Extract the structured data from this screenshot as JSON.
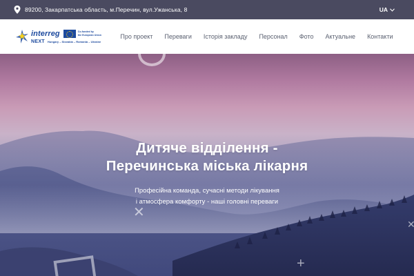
{
  "topbar": {
    "address": "89200, Закарпатська область, м.Перечин, вул.Ужанська, 8",
    "language": "UA",
    "icons": {
      "location": "map-pin-icon",
      "chevron": "chevron-down-icon"
    }
  },
  "logo": {
    "word": "interreg",
    "eu_text_line1": "Co-funded by",
    "eu_text_line2": "the European Union",
    "next": "NEXT",
    "countries": "Hungary – Slovakia – Romania – Ukraine"
  },
  "nav": {
    "items": [
      {
        "label": "Про проект"
      },
      {
        "label": "Переваги"
      },
      {
        "label": "Історія закладу"
      },
      {
        "label": "Персонал"
      },
      {
        "label": "Фото"
      },
      {
        "label": "Актуальне"
      },
      {
        "label": "Контакти"
      }
    ]
  },
  "hero": {
    "title_line1": "Дитяче відділення -",
    "title_line2": "Перечинська міська лікарня",
    "subtitle_line1": "Професійна команда, сучасні методи лікування",
    "subtitle_line2": "і атмосфера комфорту - наші головні переваги"
  },
  "colors": {
    "topbar_bg": "#4a4a60",
    "brand_blue": "#1d4a9e",
    "nav_text": "#5a6070",
    "eu_yellow": "#f9d21b"
  }
}
